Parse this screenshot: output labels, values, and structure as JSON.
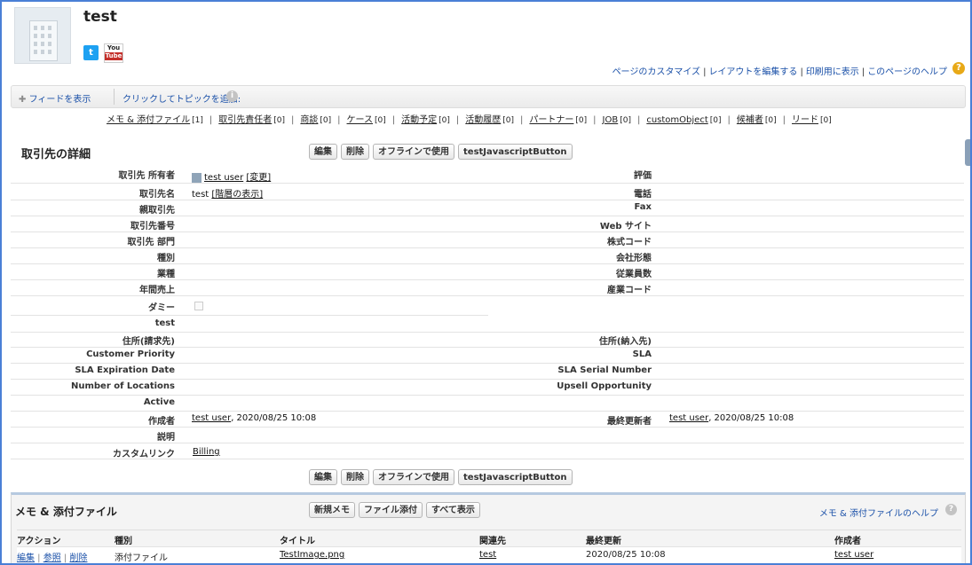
{
  "header": {
    "title": "test",
    "links": [
      "ページのカスタマイズ",
      "レイアウトを編集する",
      "印刷用に表示",
      "このページのヘルプ"
    ]
  },
  "feed": {
    "show_feed": "フィードを表示",
    "add_topic": "クリックしてトピックを追加:"
  },
  "related_links": [
    {
      "label": "メモ & 添付ファイル",
      "count": "[1]"
    },
    {
      "label": "取引先責任者",
      "count": "[0]"
    },
    {
      "label": "商談",
      "count": "[0]"
    },
    {
      "label": "ケース",
      "count": "[0]"
    },
    {
      "label": "活動予定",
      "count": "[0]"
    },
    {
      "label": "活動履歴",
      "count": "[0]"
    },
    {
      "label": "パートナー",
      "count": "[0]"
    },
    {
      "label": "JOB",
      "count": "[0]"
    },
    {
      "label": "customObject",
      "count": "[0]"
    },
    {
      "label": "候補者",
      "count": "[0]"
    },
    {
      "label": "リード",
      "count": "[0]"
    }
  ],
  "detail": {
    "title": "取引先の詳細",
    "buttons": [
      "編集",
      "削除",
      "オフラインで使用",
      "testJavascriptButton"
    ],
    "owner_label": "取引先 所有者",
    "owner_value": "test user",
    "owner_change": "[変更]",
    "rating_label": "評価",
    "name_label": "取引先名",
    "name_value": "test",
    "name_hierarchy": "[階層の表示]",
    "phone_label": "電話",
    "parent_label": "親取引先",
    "fax_label": "Fax",
    "number_label": "取引先番号",
    "website_label": "Web サイト",
    "site_label": "取引先 部門",
    "ticker_label": "株式コード",
    "type_label": "種別",
    "ownership_label": "会社形態",
    "industry_label": "業種",
    "employees_label": "従業員数",
    "revenue_label": "年間売上",
    "sic_label": "産業コード",
    "dummy_label": "ダミー",
    "test_label": "test",
    "billing_label": "住所(請求先)",
    "shipping_label": "住所(納入先)",
    "priority_label": "Customer Priority",
    "sla_label": "SLA",
    "sla_exp_label": "SLA Expiration Date",
    "sla_serial_label": "SLA Serial Number",
    "locations_label": "Number of Locations",
    "upsell_label": "Upsell Opportunity",
    "active_label": "Active",
    "created_label": "作成者",
    "created_user": "test user",
    "created_date": ", 2020/08/25 10:08",
    "modified_label": "最終更新者",
    "modified_user": "test user",
    "modified_date": ", 2020/08/25 10:08",
    "description_label": "説明",
    "custom_links_label": "カスタムリンク",
    "custom_link": "Billing"
  },
  "notes": {
    "title": "メモ & 添付ファイル",
    "buttons": [
      "新規メモ",
      "ファイル添付",
      "すべて表示"
    ],
    "help": "メモ & 添付ファイルのヘルプ",
    "columns": [
      "アクション",
      "種別",
      "タイトル",
      "関連先",
      "最終更新",
      "作成者"
    ],
    "rows": [
      {
        "edit": "編集",
        "view": "参照",
        "del": "削除",
        "type": "添付ファイル",
        "title": "TestImage.png",
        "related": "test",
        "modified": "2020/08/25 10:08",
        "creator": "test user"
      }
    ]
  }
}
